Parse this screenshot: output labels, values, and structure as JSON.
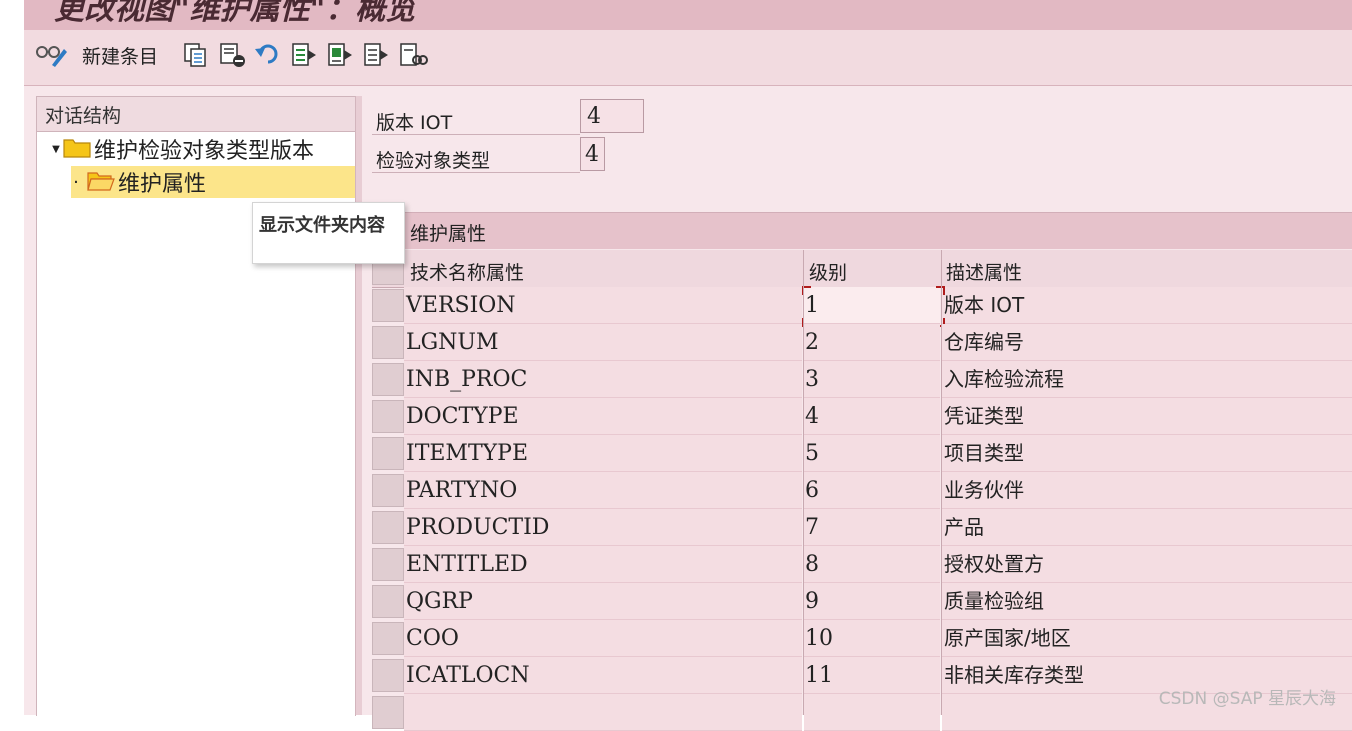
{
  "window": {
    "title": "更改视图\"维护属性\"：概览"
  },
  "toolbar": {
    "new_entry_label": "新建条目",
    "icons": [
      "glasses-icon",
      "copy-icon",
      "delete-icon",
      "undo-icon",
      "select-all-icon",
      "select-block-icon",
      "deselect-all-icon",
      "config-icon"
    ]
  },
  "dialog_structure": {
    "header": "对话结构",
    "nodes": [
      {
        "label": "维护检验对象类型版本",
        "expanded": true,
        "selected": false
      },
      {
        "label": "维护属性",
        "selected": true
      }
    ],
    "tooltip": "显示文件夹内容"
  },
  "fields": {
    "version": {
      "label": "版本 IOT",
      "value": "4"
    },
    "object_type": {
      "label": "检验对象类型",
      "value": "4"
    }
  },
  "section": {
    "title": "维护属性"
  },
  "table": {
    "columns": [
      "技术名称属性",
      "级别",
      "描述属性"
    ],
    "rows": [
      {
        "tech_name": "VERSION",
        "level": "1",
        "description": "版本 IOT"
      },
      {
        "tech_name": "LGNUM",
        "level": "2",
        "description": "仓库编号"
      },
      {
        "tech_name": "INB_PROC",
        "level": "3",
        "description": "入库检验流程"
      },
      {
        "tech_name": "DOCTYPE",
        "level": "4",
        "description": "凭证类型"
      },
      {
        "tech_name": "ITEMTYPE",
        "level": "5",
        "description": "项目类型"
      },
      {
        "tech_name": "PARTYNO",
        "level": "6",
        "description": "业务伙伴"
      },
      {
        "tech_name": "PRODUCTID",
        "level": "7",
        "description": "产品"
      },
      {
        "tech_name": "ENTITLED",
        "level": "8",
        "description": "授权处置方"
      },
      {
        "tech_name": "QGRP",
        "level": "9",
        "description": "质量检验组"
      },
      {
        "tech_name": "COO",
        "level": "10",
        "description": "原产国家/地区"
      },
      {
        "tech_name": "ICATLOCN",
        "level": "11",
        "description": "非相关库存类型"
      }
    ]
  },
  "watermark": "CSDN @SAP 星辰大海"
}
